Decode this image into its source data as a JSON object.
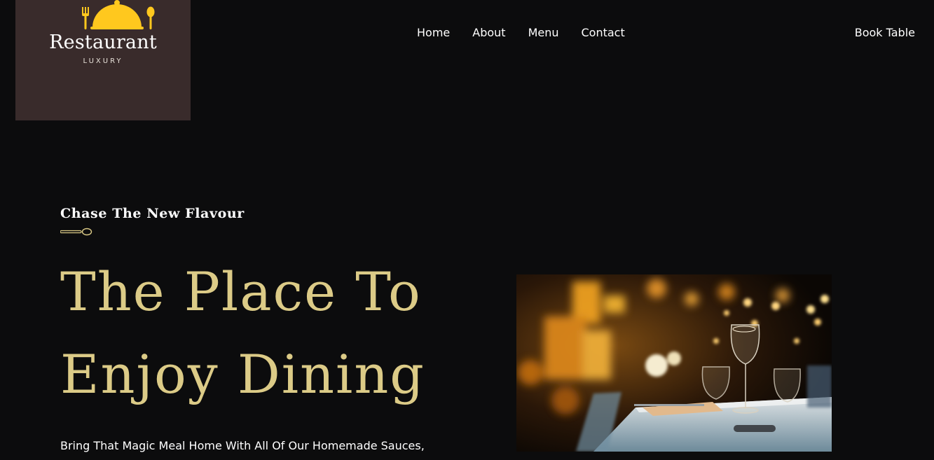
{
  "brand": {
    "name": "Restaurant",
    "tagline": "LUXURY",
    "logo_icon": "cloche-icon",
    "colors": {
      "logo_bg": "#392b2b",
      "logo_icon": "#ffc81e"
    }
  },
  "nav": {
    "items": [
      {
        "label": "Home"
      },
      {
        "label": "About"
      },
      {
        "label": "Menu"
      },
      {
        "label": "Contact"
      }
    ],
    "cta_label": "Book Table"
  },
  "hero": {
    "eyebrow": "Chase The New Flavour",
    "divider_icon": "spoon-icon",
    "headline_line1": "The Place To",
    "headline_line2": "Enjoy Dining",
    "description": "Bring That Magic Meal Home With All Of Our Homemade Sauces,",
    "image_subject": "dining-table-wine-glasses-photo",
    "colors": {
      "headline": "#dccb87",
      "background": "#0c0c0d",
      "text": "#ffffff"
    }
  }
}
